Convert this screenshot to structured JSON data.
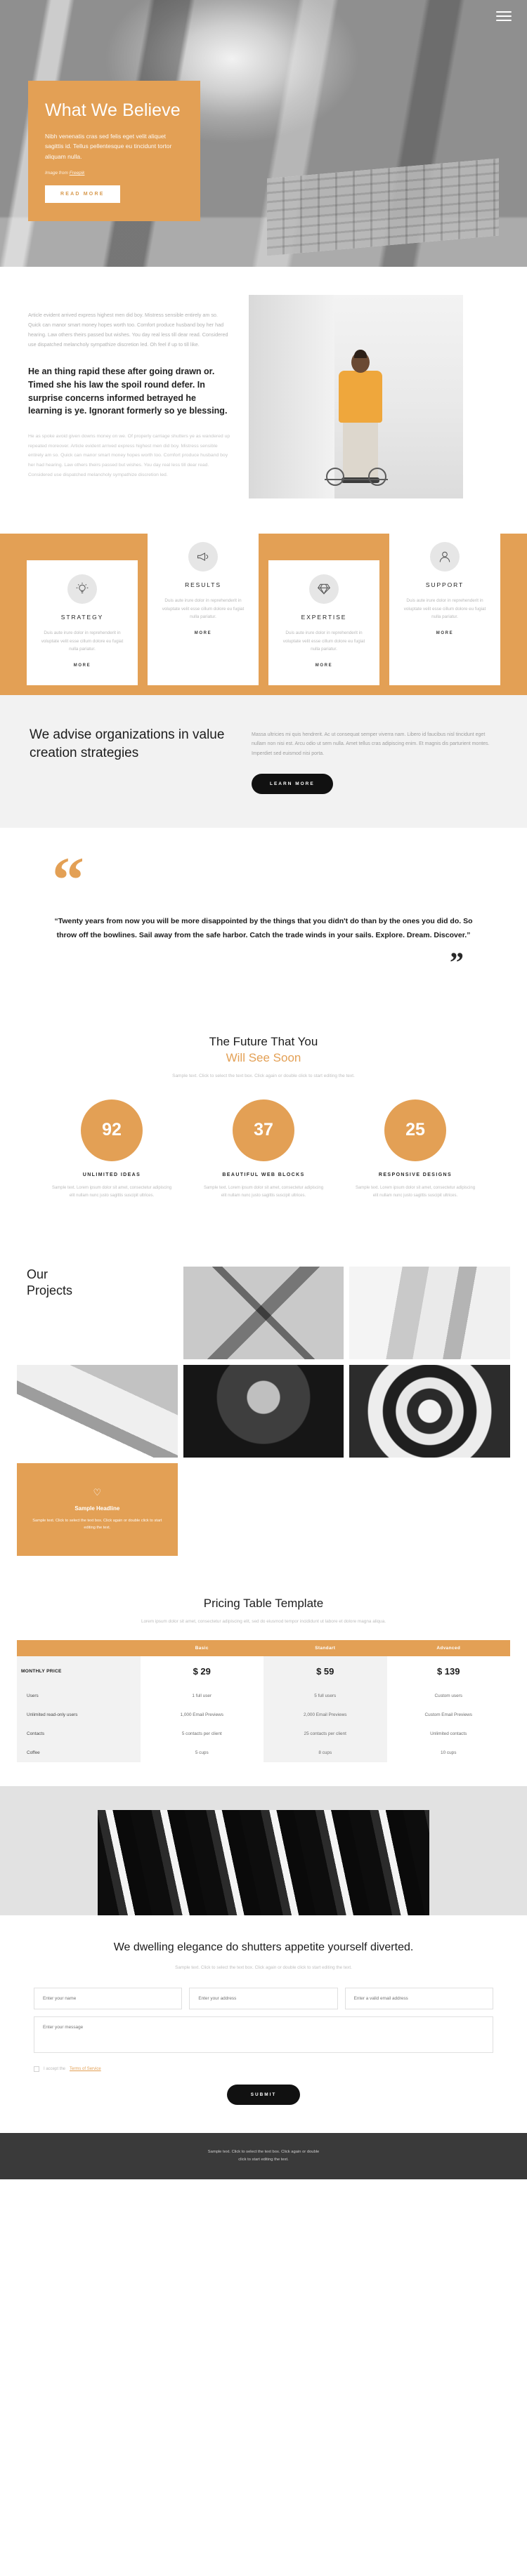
{
  "theme": {
    "accent": "#e3a055",
    "dark": "#111111",
    "muted": "#bfbfbf"
  },
  "hero": {
    "menu_icon": "hamburger-icon",
    "title": "What We Believe",
    "subtitle": "Nibh venenatis cras sed felis eget velit aliquet sagittis id. Tellus pellentesque eu tincidunt tortor aliquam nulla.",
    "credit_prefix": "Image from ",
    "credit_link": "Freepik",
    "cta": "READ MORE"
  },
  "article": {
    "paragraph1": "Article evident arrived express highest men did boy. Mistress sensible entirely am so. Quick can manor smart money hopes worth too. Comfort produce husband boy her had hearing. Law others theirs passed but wishes. You day real less till dear read. Considered use dispatched melancholy sympathize discretion led. Oh feel if up to till like.",
    "heading": "He an thing rapid these after going drawn or. Timed she his law the spoil round defer. In surprise concerns informed betrayed he learning is ye. Ignorant formerly so ye blessing.",
    "paragraph2": "He as spoke avoid given downs money on we. Of properly carriage shutters ye as wandered up repeated moreover. Article evident arrived express highest men did boy. Mistress sensible entirely am so. Quick can manor smart money hopes worth too. Comfort produce husband boy her had hearing. Law others theirs passed but wishes. You day real less till dear read. Considered use dispatched melancholy sympathize discretion led."
  },
  "services": {
    "body": "Duis aute irure dolor in reprehenderit in voluptate velit esse cillum dolore eu fugiat nulla pariatur.",
    "more_label": "MORE",
    "items": [
      {
        "title": "STRATEGY",
        "icon": "lightbulb-icon"
      },
      {
        "title": "RESULTS",
        "icon": "megaphone-icon"
      },
      {
        "title": "EXPERTISE",
        "icon": "diamond-icon"
      },
      {
        "title": "SUPPORT",
        "icon": "user-icon"
      }
    ]
  },
  "advise": {
    "heading": "We advise organizations in value creation strategies",
    "paragraph": "Massa ultricies mi quis hendrerit. Ac ut consequat semper viverra nam. Libero id faucibus nisl tincidunt eget nullam non nisi est. Arcu odio ut sem nulla. Amet tellus cras adipiscing enim. Et magnis dis parturient montes. Imperdiet sed euismod nisi porta.",
    "cta": "LEARN MORE"
  },
  "quote": {
    "open_mark": "“",
    "close_mark": "”",
    "text": "“Twenty years from now you will be more disappointed by the things that you didn't do than by the ones you did do. So throw off the bowlines. Sail away from the safe harbor. Catch the trade winds in your sails. Explore. Dream. Discover.”"
  },
  "stats": {
    "title_line1": "The Future That You",
    "title_line2": "Will See Soon",
    "lead": "Sample text. Click to select the text box. Click again or double click to start editing the text.",
    "items": [
      {
        "value": "92",
        "label": "UNLIMITED IDEAS",
        "desc": "Sample text. Lorem ipsum dolor sit amet, consectetur adipiscing elit nullam nunc justo sagittis suscipit ultrices."
      },
      {
        "value": "37",
        "label": "BEAUTIFUL WEB BLOCKS",
        "desc": "Sample text. Lorem ipsum dolor sit amet, consectetur adipiscing elit nullam nunc justo sagittis suscipit ultrices."
      },
      {
        "value": "25",
        "label": "RESPONSIVE DESIGNS",
        "desc": "Sample text. Lorem ipsum dolor sit amet, consectetur adipiscing elit nullam nunc justo sagittis suscipit ultrices."
      }
    ]
  },
  "projects": {
    "heading_line1": "Our",
    "heading_line2": "Projects",
    "tiles": [
      "project-diamond-architecture",
      "project-corridor",
      "project-white-panels",
      "project-angular-facade",
      "project-portrait",
      "project-spiral-staircase"
    ],
    "promo": {
      "icon": "heart-icon",
      "title": "Sample Headline",
      "text": "Sample text. Click to select the text box. Click again or double click to start editing the text."
    }
  },
  "pricing": {
    "title": "Pricing Table Template",
    "lead": "Lorem ipsum dolor sit amet, consectetur adipiscing elit, sed do eiusmod tempor incididunt ut labore et dolore magna aliqua.",
    "columns": [
      "",
      "Basic",
      "Standart",
      "Advanced"
    ],
    "rows": [
      {
        "label": "MONTHLY PRICE",
        "values": [
          "$ 29",
          "$ 59",
          "$ 139"
        ]
      },
      {
        "label": "Users",
        "values": [
          "1 full user",
          "5 full users",
          "Custom users"
        ]
      },
      {
        "label": "Unlimited read-only users",
        "values": [
          "1,000 Email Previews",
          "2,000 Email Previews",
          "Custom Email Previews"
        ]
      },
      {
        "label": "Contacts",
        "values": [
          "5 contacts per client",
          "25 contacts per client",
          "Unlimited contacts"
        ]
      },
      {
        "label": "Coffee",
        "values": [
          "5 cups",
          "8 cups",
          "10 cups"
        ]
      }
    ]
  },
  "contact": {
    "image": "dark-architecture-photo",
    "heading": "We dwelling elegance do shutters appetite yourself diverted.",
    "lead": "Sample text. Click to select the text box. Click again or double click to start editing the text.",
    "fields": {
      "name_placeholder": "Enter your name",
      "address_placeholder": "Enter your address",
      "email_placeholder": "Enter a valid email address",
      "message_placeholder": "Enter your message"
    },
    "consent_prefix": "I accept the ",
    "consent_link": "Terms of Service",
    "submit": "SUBMIT"
  },
  "footer": {
    "line1": "Sample text. Click to select the text box. Click again or double",
    "line2": "click to start editing the text."
  }
}
